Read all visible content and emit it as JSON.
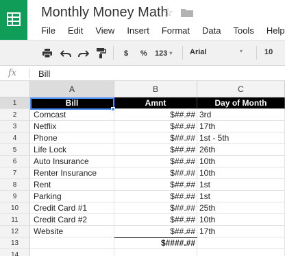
{
  "app": {
    "title": "Monthly Money Math",
    "menu": [
      "File",
      "Edit",
      "View",
      "Insert",
      "Format",
      "Data",
      "Tools",
      "Help"
    ]
  },
  "toolbar": {
    "currency_label": "$",
    "percent_label": "%",
    "number_format_label": "123",
    "font_name": "Arial",
    "font_size": "10"
  },
  "formula_bar": {
    "fx_label": "fx",
    "value": "Bill"
  },
  "columns": [
    "A",
    "B",
    "C"
  ],
  "selected_cell": "A1",
  "rows": [
    {
      "num": "1",
      "a": "Bill",
      "b": "Amnt",
      "c": "Day of Month"
    },
    {
      "num": "2",
      "a": "Comcast",
      "b": "$##.##",
      "c": "3rd"
    },
    {
      "num": "3",
      "a": "Netflix",
      "b": "$##.##",
      "c": "17th"
    },
    {
      "num": "4",
      "a": "Phone",
      "b": "$##.##",
      "c": "1st - 5th"
    },
    {
      "num": "5",
      "a": "Life Lock",
      "b": "$##.##",
      "c": "26th"
    },
    {
      "num": "6",
      "a": "Auto Insurance",
      "b": "$##.##",
      "c": "10th"
    },
    {
      "num": "7",
      "a": "Renter Insurance",
      "b": "$##.##",
      "c": "10th"
    },
    {
      "num": "8",
      "a": "Rent",
      "b": "$##.##",
      "c": "1st"
    },
    {
      "num": "9",
      "a": "Parking",
      "b": "$##.##",
      "c": "1st"
    },
    {
      "num": "10",
      "a": "Credit Card #1",
      "b": "$##.##",
      "c": "25th"
    },
    {
      "num": "11",
      "a": "Credit Card #2",
      "b": "$##.##",
      "c": "10th"
    },
    {
      "num": "12",
      "a": "Website",
      "b": "$##.##",
      "c": "17th"
    },
    {
      "num": "13",
      "a": "",
      "b": "$####.##",
      "c": ""
    },
    {
      "num": "14",
      "a": "",
      "b": "",
      "c": ""
    }
  ],
  "colors": {
    "brand": "#0f9d58",
    "header_row_bg": "#000000",
    "selection": "#4d90fe"
  }
}
